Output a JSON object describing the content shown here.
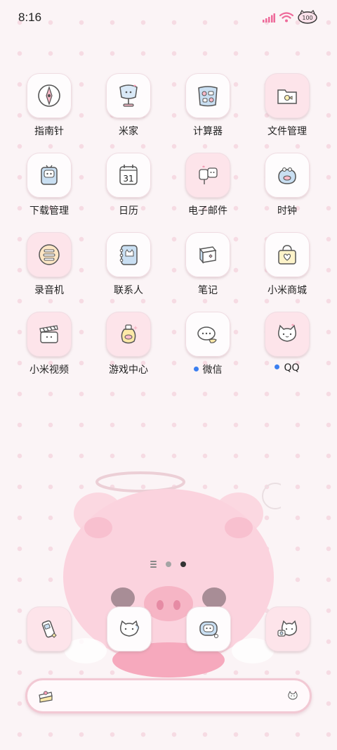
{
  "status_bar": {
    "time": "8:16",
    "battery": "100",
    "accent_color": "#ee6a9a"
  },
  "apps": [
    {
      "label": "指南针",
      "icon": "compass-icon"
    },
    {
      "label": "米家",
      "icon": "mijia-lamp-icon"
    },
    {
      "label": "计算器",
      "icon": "calculator-icon"
    },
    {
      "label": "文件管理",
      "icon": "folder-icon"
    },
    {
      "label": "下载管理",
      "icon": "download-bag-icon"
    },
    {
      "label": "日历",
      "icon": "calendar-icon",
      "date": "31"
    },
    {
      "label": "电子邮件",
      "icon": "mailbox-icon"
    },
    {
      "label": "时钟",
      "icon": "clock-purse-icon"
    },
    {
      "label": "录音机",
      "icon": "recorder-icon"
    },
    {
      "label": "联系人",
      "icon": "contacts-book-icon"
    },
    {
      "label": "笔记",
      "icon": "notes-icon"
    },
    {
      "label": "小米商城",
      "icon": "shop-bag-icon"
    },
    {
      "label": "小米视频",
      "icon": "video-clapper-icon"
    },
    {
      "label": "游戏中心",
      "icon": "game-potion-icon"
    },
    {
      "label": "微信",
      "icon": "wechat-bubble-icon",
      "badge": true
    },
    {
      "label": "QQ",
      "icon": "qq-cat-icon",
      "badge": true
    }
  ],
  "pager": {
    "pages": 2,
    "active": 2
  },
  "dock": [
    {
      "name": "phone",
      "icon": "phone-icon"
    },
    {
      "name": "messages",
      "icon": "messages-cat-icon"
    },
    {
      "name": "browser",
      "icon": "browser-bubble-icon"
    },
    {
      "name": "camera",
      "icon": "camera-cat-icon"
    }
  ],
  "search": {
    "left_icon": "cake-icon",
    "right_icon": "mic-icon"
  }
}
